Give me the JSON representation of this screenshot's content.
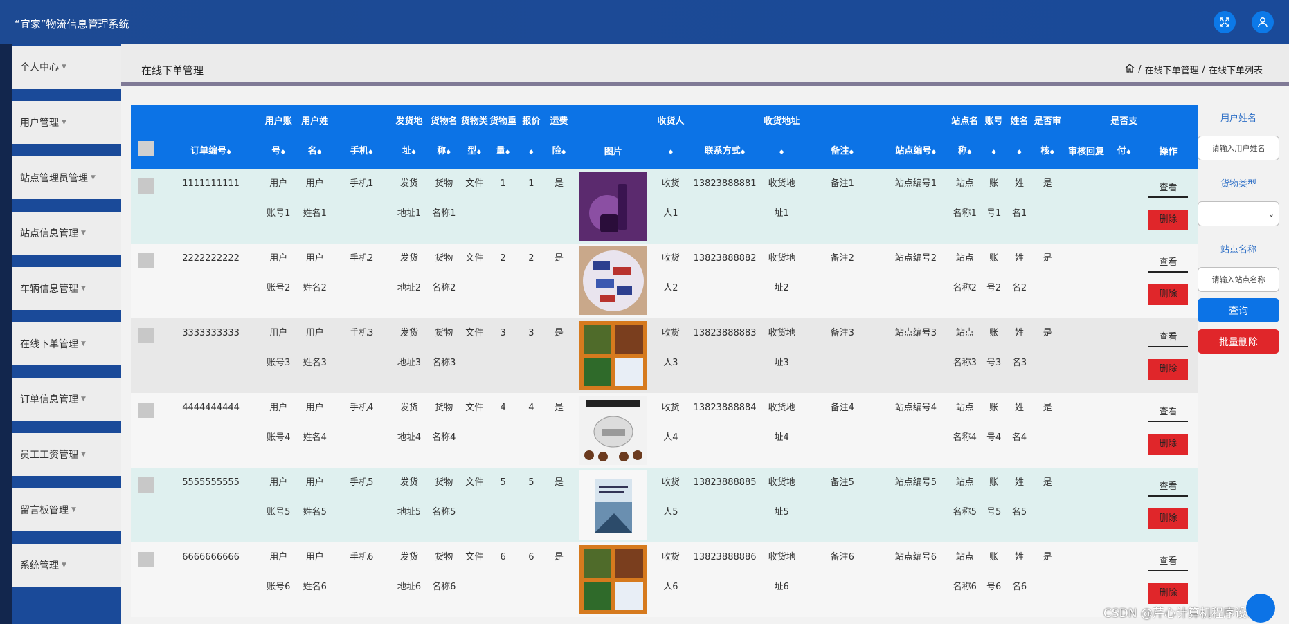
{
  "app": {
    "title": "“宜家”物流信息管理系统"
  },
  "sidebar": {
    "items": [
      {
        "label": "个人中心"
      },
      {
        "label": "用户管理"
      },
      {
        "label": "站点管理员管理"
      },
      {
        "label": "站点信息管理"
      },
      {
        "label": "车辆信息管理"
      },
      {
        "label": "在线下单管理"
      },
      {
        "label": "订单信息管理"
      },
      {
        "label": "员工工资管理"
      },
      {
        "label": "留言板管理"
      },
      {
        "label": "系统管理"
      }
    ]
  },
  "header": {
    "page_title": "在线下单管理",
    "breadcrumb": [
      "在线下单管理",
      "在线下单列表"
    ],
    "separator": "/"
  },
  "table": {
    "columns": [
      {
        "top": "",
        "bottom": "订单编号"
      },
      {
        "top": "用户账",
        "bottom": "号"
      },
      {
        "top": "用户姓",
        "bottom": "名"
      },
      {
        "top": "",
        "bottom": "手机"
      },
      {
        "top": "发货地",
        "bottom": "址"
      },
      {
        "top": "货物名",
        "bottom": "称"
      },
      {
        "top": "货物类",
        "bottom": "型"
      },
      {
        "top": "货物重",
        "bottom": "量"
      },
      {
        "top": "报价",
        "bottom": ""
      },
      {
        "top": "运费",
        "bottom": "险"
      },
      {
        "top": "",
        "bottom": "图片"
      },
      {
        "top": "收货人",
        "bottom": ""
      },
      {
        "top": "",
        "bottom": "联系方式"
      },
      {
        "top": "收货地址",
        "bottom": ""
      },
      {
        "top": "",
        "bottom": "备注"
      },
      {
        "top": "",
        "bottom": "站点编号"
      },
      {
        "top": "站点名",
        "bottom": "称"
      },
      {
        "top": "账号",
        "bottom": ""
      },
      {
        "top": "姓名",
        "bottom": ""
      },
      {
        "top": "是否审",
        "bottom": "核"
      },
      {
        "top": "",
        "bottom": "审核回复"
      },
      {
        "top": "是否支",
        "bottom": "付"
      },
      {
        "top": "",
        "bottom": "操作"
      }
    ],
    "rows": [
      {
        "order_no": "1111111111",
        "acct": [
          "用户",
          "账号1"
        ],
        "name": [
          "用户",
          "姓名1"
        ],
        "phone": "手机1",
        "addr": [
          "发货",
          "地址1"
        ],
        "goods": [
          "货物",
          "名称1"
        ],
        "type": "文件",
        "weight": "1",
        "price": "1",
        "insured": "是",
        "image": "cosmetics",
        "recv": [
          "收货",
          "人1"
        ],
        "contact": "13823888881",
        "recv_addr": [
          "收货地",
          "址1"
        ],
        "note": "备注1",
        "station_no": "站点编号1",
        "station": [
          "站点",
          "名称1"
        ],
        "sacct": [
          "账",
          "号1"
        ],
        "sname": [
          "姓",
          "名1"
        ],
        "audited": "是",
        "reply": "",
        "paid": ""
      },
      {
        "order_no": "2222222222",
        "acct": [
          "用户",
          "账号2"
        ],
        "name": [
          "用户",
          "姓名2"
        ],
        "phone": "手机2",
        "addr": [
          "发货",
          "地址2"
        ],
        "goods": [
          "货物",
          "名称2"
        ],
        "type": "文件",
        "weight": "2",
        "price": "2",
        "insured": "是",
        "image": "candy",
        "recv": [
          "收货",
          "人2"
        ],
        "contact": "13823888882",
        "recv_addr": [
          "收货地",
          "址2"
        ],
        "note": "备注2",
        "station_no": "站点编号2",
        "station": [
          "站点",
          "名称2"
        ],
        "sacct": [
          "账",
          "号2"
        ],
        "sname": [
          "姓",
          "名2"
        ],
        "audited": "是",
        "reply": "",
        "paid": ""
      },
      {
        "order_no": "3333333333",
        "acct": [
          "用户",
          "账号3"
        ],
        "name": [
          "用户",
          "姓名3"
        ],
        "phone": "手机3",
        "addr": [
          "发货",
          "地址3"
        ],
        "goods": [
          "货物",
          "名称3"
        ],
        "type": "文件",
        "weight": "3",
        "price": "3",
        "insured": "是",
        "image": "bento",
        "recv": [
          "收货",
          "人3"
        ],
        "contact": "13823888883",
        "recv_addr": [
          "收货地",
          "址3"
        ],
        "note": "备注3",
        "station_no": "站点编号3",
        "station": [
          "站点",
          "名称3"
        ],
        "sacct": [
          "账",
          "号3"
        ],
        "sname": [
          "姓",
          "名3"
        ],
        "audited": "是",
        "reply": "",
        "paid": ""
      },
      {
        "order_no": "4444444444",
        "acct": [
          "用户",
          "账号4"
        ],
        "name": [
          "用户",
          "姓名4"
        ],
        "phone": "手机4",
        "addr": [
          "发货",
          "地址4"
        ],
        "goods": [
          "货物",
          "名称4"
        ],
        "type": "文件",
        "weight": "4",
        "price": "4",
        "insured": "是",
        "image": "cooker",
        "recv": [
          "收货",
          "人4"
        ],
        "contact": "13823888884",
        "recv_addr": [
          "收货地",
          "址4"
        ],
        "note": "备注4",
        "station_no": "站点编号4",
        "station": [
          "站点",
          "名称4"
        ],
        "sacct": [
          "账",
          "号4"
        ],
        "sname": [
          "姓",
          "名4"
        ],
        "audited": "是",
        "reply": "",
        "paid": ""
      },
      {
        "order_no": "5555555555",
        "acct": [
          "用户",
          "账号5"
        ],
        "name": [
          "用户",
          "姓名5"
        ],
        "phone": "手机5",
        "addr": [
          "发货",
          "地址5"
        ],
        "goods": [
          "货物",
          "名称5"
        ],
        "type": "文件",
        "weight": "5",
        "price": "5",
        "insured": "是",
        "image": "book",
        "recv": [
          "收货",
          "人5"
        ],
        "contact": "13823888885",
        "recv_addr": [
          "收货地",
          "址5"
        ],
        "note": "备注5",
        "station_no": "站点编号5",
        "station": [
          "站点",
          "名称5"
        ],
        "sacct": [
          "账",
          "号5"
        ],
        "sname": [
          "姓",
          "名5"
        ],
        "audited": "是",
        "reply": "",
        "paid": ""
      },
      {
        "order_no": "6666666666",
        "acct": [
          "用户",
          "账号6"
        ],
        "name": [
          "用户",
          "姓名6"
        ],
        "phone": "手机6",
        "addr": [
          "发货",
          "地址6"
        ],
        "goods": [
          "货物",
          "名称6"
        ],
        "type": "文件",
        "weight": "6",
        "price": "6",
        "insured": "是",
        "image": "bento",
        "recv": [
          "收货",
          "人6"
        ],
        "contact": "13823888886",
        "recv_addr": [
          "收货地",
          "址6"
        ],
        "note": "备注6",
        "station_no": "站点编号6",
        "station": [
          "站点",
          "名称6"
        ],
        "sacct": [
          "账",
          "号6"
        ],
        "sname": [
          "姓",
          "名6"
        ],
        "audited": "是",
        "reply": "",
        "paid": ""
      }
    ],
    "actions": {
      "view": "查看",
      "delete": "删除"
    }
  },
  "search": {
    "username_label": "用户姓名",
    "username_placeholder": "请输入用户姓名",
    "goods_type_label": "货物类型",
    "goods_type_value": "",
    "station_label": "站点名称",
    "station_placeholder": "请输入站点名称",
    "query_label": "查询",
    "batch_delete_label": "批量删除"
  },
  "watermark": "CSDN @芹心计算机程序设计",
  "colors": {
    "primary": "#0c73e6",
    "danger": "#e0262a",
    "topbar": "#1a4a99",
    "label": "#2e6fc6"
  }
}
